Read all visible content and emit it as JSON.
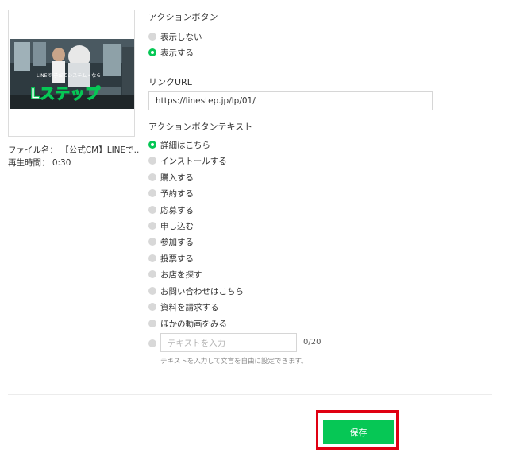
{
  "video": {
    "file_label": "ファイル名：",
    "file_name": "【公式CM】LINEで...",
    "duration_label": "再生時間：",
    "duration": "0:30",
    "thumb_logo": "Lステップ",
    "thumb_caption": "LINEで 子だてシステム・なら"
  },
  "action_button": {
    "label": "アクションボタン",
    "options": [
      {
        "label": "表示しない",
        "selected": false
      },
      {
        "label": "表示する",
        "selected": true
      }
    ]
  },
  "link_url": {
    "label": "リンクURL",
    "value": "https://linestep.jp/lp/01/"
  },
  "button_text": {
    "label": "アクションボタンテキスト",
    "options": [
      {
        "label": "詳細はこちら",
        "selected": true
      },
      {
        "label": "インストールする",
        "selected": false
      },
      {
        "label": "購入する",
        "selected": false
      },
      {
        "label": "予約する",
        "selected": false
      },
      {
        "label": "応募する",
        "selected": false
      },
      {
        "label": "申し込む",
        "selected": false
      },
      {
        "label": "参加する",
        "selected": false
      },
      {
        "label": "投票する",
        "selected": false
      },
      {
        "label": "お店を探す",
        "selected": false
      },
      {
        "label": "お問い合わせはこちら",
        "selected": false
      },
      {
        "label": "資料を請求する",
        "selected": false
      },
      {
        "label": "ほかの動画をみる",
        "selected": false
      }
    ],
    "custom_placeholder": "テキストを入力",
    "counter": "0/20",
    "help": "テキストを入力して文言を自由に設定できます。"
  },
  "save_label": "保存",
  "colors": {
    "accent": "#06c755",
    "highlight": "#e00012"
  }
}
